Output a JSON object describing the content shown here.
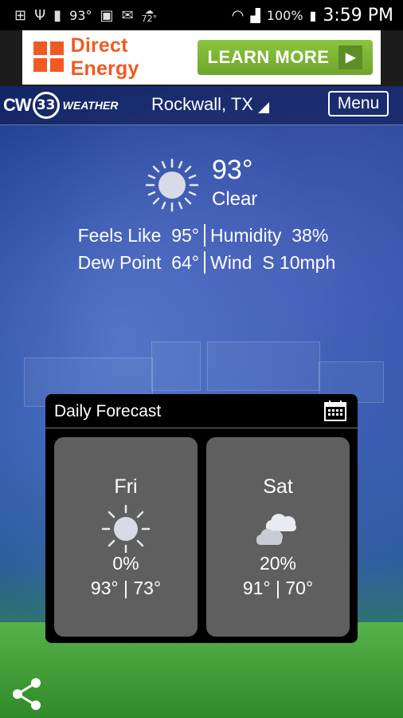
{
  "status_bar": {
    "temperature": "93°",
    "weather_small": "72°",
    "battery": "100%",
    "time": "3:59 PM"
  },
  "ad": {
    "brand": "Direct Energy",
    "cta": "LEARN MORE",
    "colors": {
      "brand": "#f05a22",
      "cta": "#8bc53f"
    }
  },
  "header": {
    "logo_cw": "CW",
    "logo_number": "33",
    "logo_weather": "WEATHER",
    "location": "Rockwall, TX",
    "menu_label": "Menu"
  },
  "current": {
    "icon": "sun-icon",
    "temperature": "93°",
    "condition": "Clear",
    "feels_like_label": "Feels Like",
    "feels_like_value": "95°",
    "humidity_label": "Humidity",
    "humidity_value": "38%",
    "dew_point_label": "Dew Point",
    "dew_point_value": "64°",
    "wind_label": "Wind",
    "wind_value": "S 10mph"
  },
  "daily_forecast": {
    "title": "Daily Forecast",
    "days": [
      {
        "day": "Fri",
        "icon": "sun-icon",
        "precip": "0%",
        "hilo": "93° | 73°"
      },
      {
        "day": "Sat",
        "icon": "clouds-icon",
        "precip": "20%",
        "hilo": "91° | 70°"
      }
    ]
  }
}
